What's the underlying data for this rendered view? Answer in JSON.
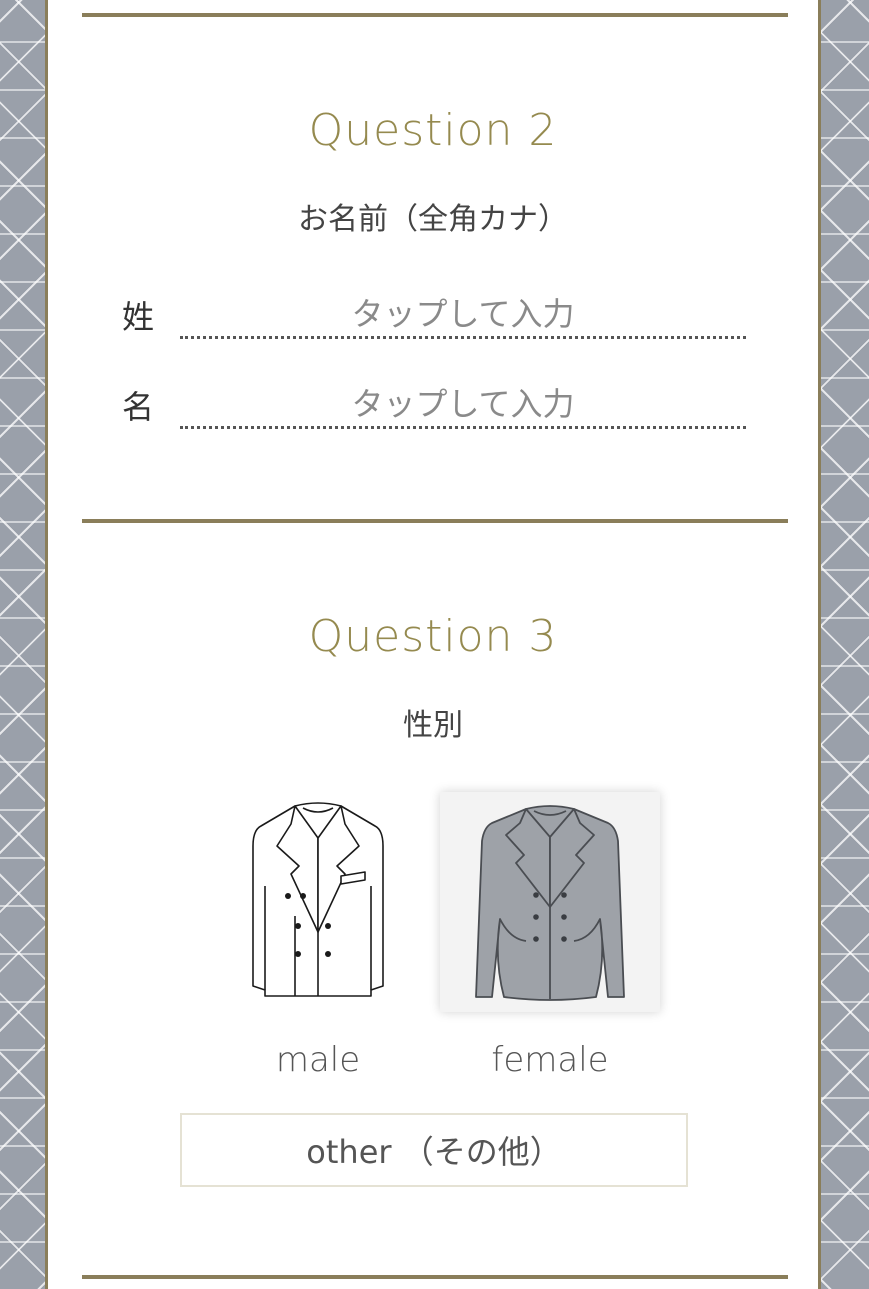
{
  "question2": {
    "title": "Question 2",
    "subtitle": "お名前（全角カナ）",
    "fields": [
      {
        "label": "姓",
        "placeholder": "タップして入力",
        "value": ""
      },
      {
        "label": "名",
        "placeholder": "タップして入力",
        "value": ""
      }
    ]
  },
  "question3": {
    "title": "Question 3",
    "subtitle": "性別",
    "options": [
      {
        "label": "male",
        "icon": "male-jacket-icon",
        "selected": false
      },
      {
        "label": "female",
        "icon": "female-jacket-icon",
        "selected": true
      }
    ],
    "other_label": "other （その他）"
  },
  "colors": {
    "accent": "#8a7e5a",
    "title": "#958a4f",
    "background_pattern": "#9aa0aa",
    "female_jacket_fill": "#9ea2a8"
  }
}
